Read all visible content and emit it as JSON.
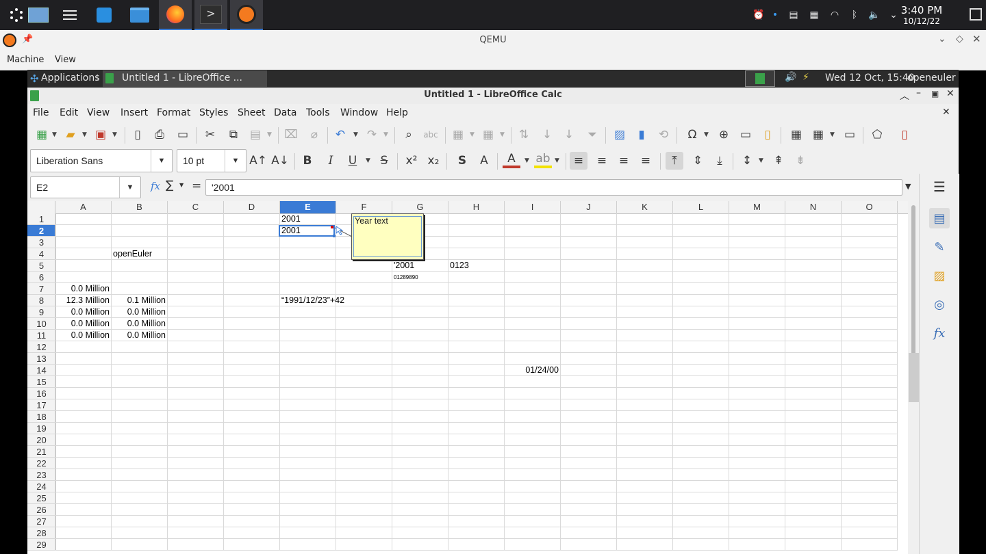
{
  "host": {
    "tray_time": "3:40 PM",
    "tray_date": "10/12/22",
    "taskbar_icons": [
      "start-icon",
      "desktop-icon",
      "task-view-icon",
      "store-icon",
      "files-icon",
      "firefox-icon",
      "terminal-icon",
      "qemu-icon"
    ]
  },
  "qemu": {
    "title": "QEMU",
    "menu": [
      "Machine",
      "View"
    ]
  },
  "guest_panel": {
    "applications": "Applications",
    "task_label": "Untitled 1 - LibreOffice ...",
    "datetime": "Wed 12 Oct, 15:40",
    "user": "openeuler"
  },
  "lo": {
    "title": "Untitled 1 - LibreOffice Calc",
    "menu": [
      "File",
      "Edit",
      "View",
      "Insert",
      "Format",
      "Styles",
      "Sheet",
      "Data",
      "Tools",
      "Window",
      "Help"
    ],
    "font_name": "Liberation Sans",
    "font_size": "10 pt",
    "name_box": "E2",
    "formula": "'2001",
    "sum_symbol": "∑",
    "fx_symbol": "fx",
    "equals": "="
  },
  "sheet": {
    "columns": [
      "A",
      "B",
      "C",
      "D",
      "E",
      "F",
      "G",
      "H",
      "I",
      "J",
      "K",
      "L",
      "M",
      "N",
      "O"
    ],
    "selected_column": "E",
    "selected_row": 2,
    "rows": [
      "1",
      "2",
      "3",
      "4",
      "5",
      "6",
      "7",
      "8",
      "9",
      "10",
      "11",
      "12",
      "13",
      "14",
      "15",
      "16",
      "17",
      "18",
      "19",
      "20",
      "21",
      "22",
      "23",
      "24",
      "25",
      "26",
      "27",
      "28",
      "29"
    ],
    "cells": {
      "E1": "2001",
      "E2": "2001",
      "B4": "openEuler",
      "G5": "'2001",
      "H5": "0123",
      "G6": "01289890",
      "A7": "0.0 Million",
      "A8": "12.3 Million",
      "B8": "0.1 Million",
      "E8": "“1991/12/23”+42",
      "A9": "0.0 Million",
      "B9": "0.0 Million",
      "A10": "0.0 Million",
      "B10": "0.0 Million",
      "A11": "0.0 Million",
      "B11": "0.0 Million",
      "I14": "01/24/00"
    },
    "comment_text": "Year text"
  },
  "colors": {
    "selection": "#3a7bd5",
    "comment_bg": "#ffffc0",
    "comment_marker": "#e00000"
  }
}
